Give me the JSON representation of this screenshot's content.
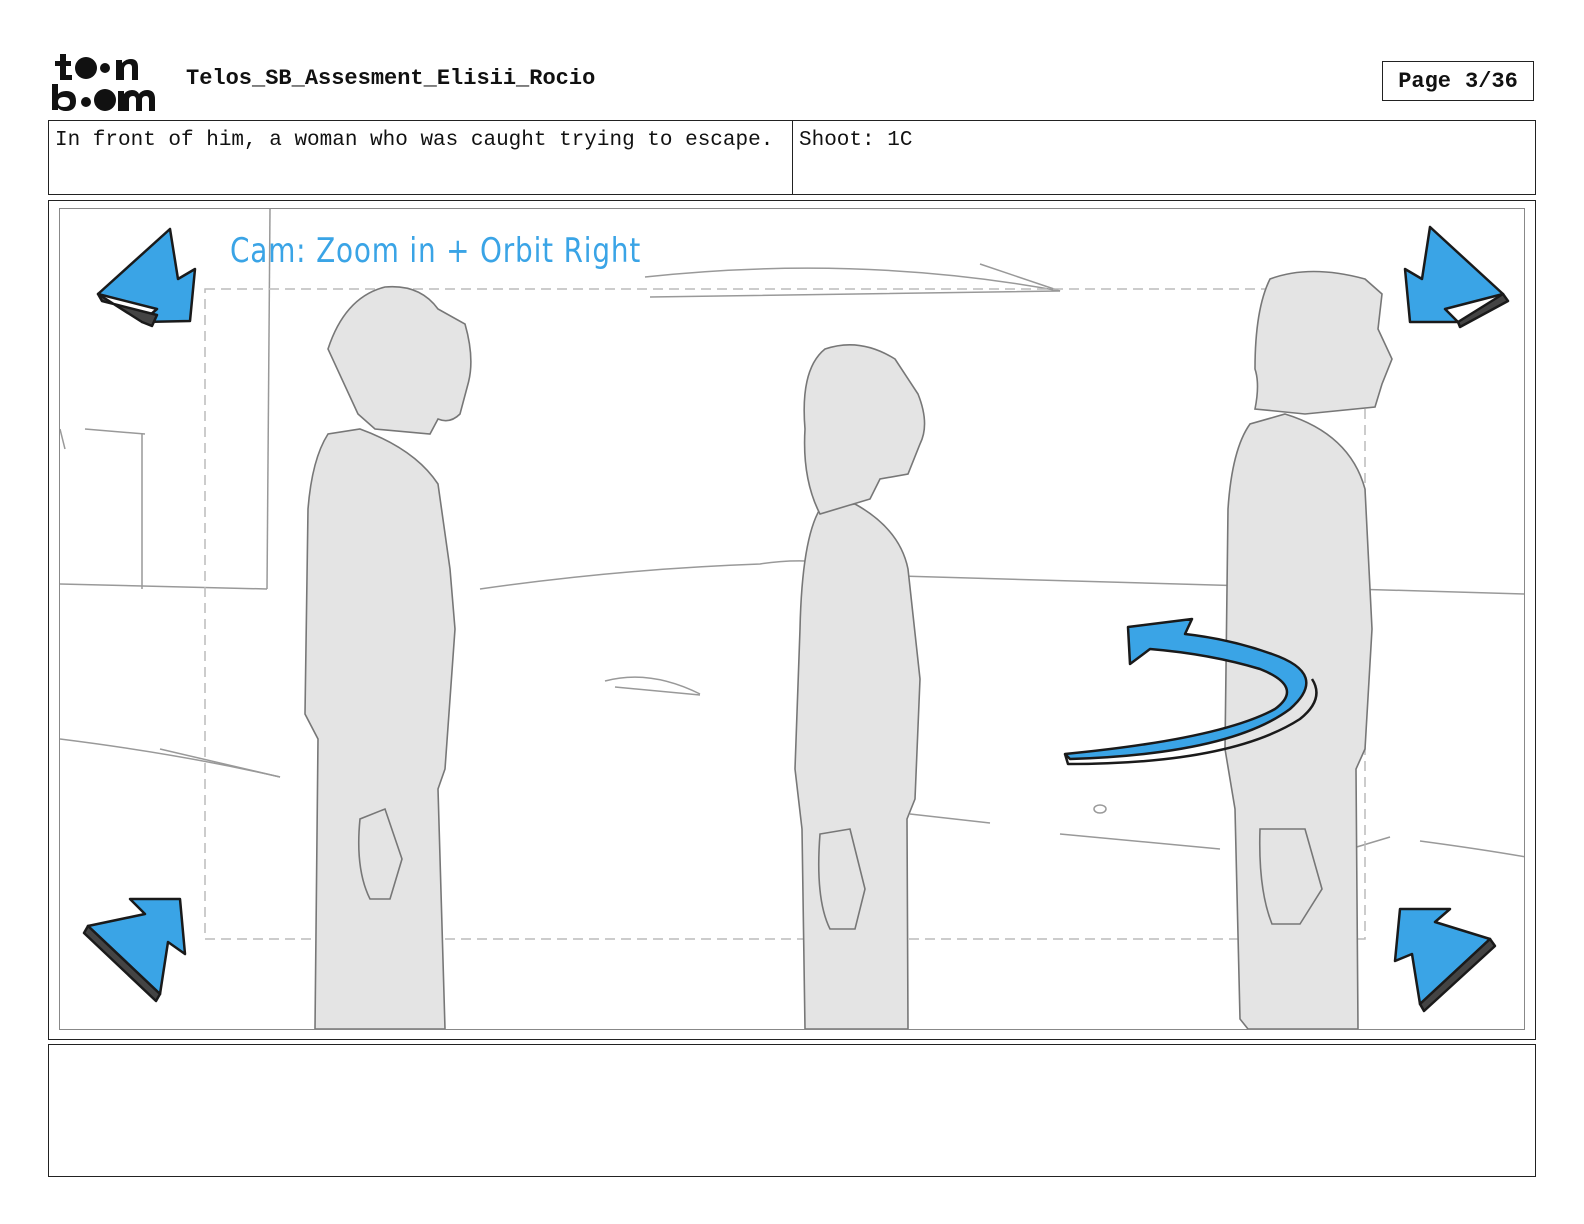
{
  "header": {
    "logo_text": "toon boom",
    "document_title": "Telos_SB_Assesment_Elisii_Rocio",
    "page_label": "Page",
    "page_number": "3/36"
  },
  "panel_info": {
    "description": "In front of him, a woman who was caught trying to escape.",
    "shoot_label": "Shoot: 1C"
  },
  "panel": {
    "camera_note": "Cam: Zoom in  + Orbit  Right",
    "accent_color": "#3aa4e6"
  },
  "notes": {
    "text": ""
  }
}
